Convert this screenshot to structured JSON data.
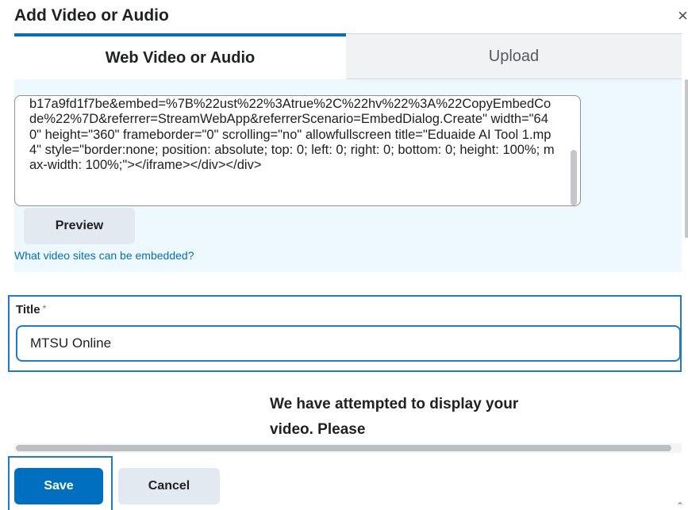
{
  "dialog": {
    "title": "Add Video or Audio",
    "close_glyph": "×"
  },
  "tabs": [
    {
      "label": "Web Video or Audio",
      "active": true
    },
    {
      "label": "Upload",
      "active": false
    }
  ],
  "embed": {
    "code": "b17a9fd1f7be&embed=%7B%22ust%22%3Atrue%2C%22hv%22%3A%22CopyEmbedCode%22%7D&referrer=StreamWebApp&referrerScenario=EmbedDialog.Create\" width=\"640\" height=\"360\" frameborder=\"0\" scrolling=\"no\" allowfullscreen title=\"Eduaide AI Tool 1.mp4\" style=\"border:none; position: absolute; top: 0; left: 0; right: 0; bottom: 0; height: 100%; max-width: 100%;\"></iframe></div></div>",
    "preview_label": "Preview",
    "sites_link": "What video sites can be embedded?"
  },
  "title_field": {
    "label": "Title",
    "required_mark": "*",
    "value": "MTSU Online"
  },
  "preview_message": "We have attempted to display your video. Please",
  "footer": {
    "save_label": "Save",
    "cancel_label": "Cancel"
  },
  "colors": {
    "accent": "#006fbf",
    "focus": "#1d7ad6",
    "panel_bg": "#eef9ff"
  }
}
